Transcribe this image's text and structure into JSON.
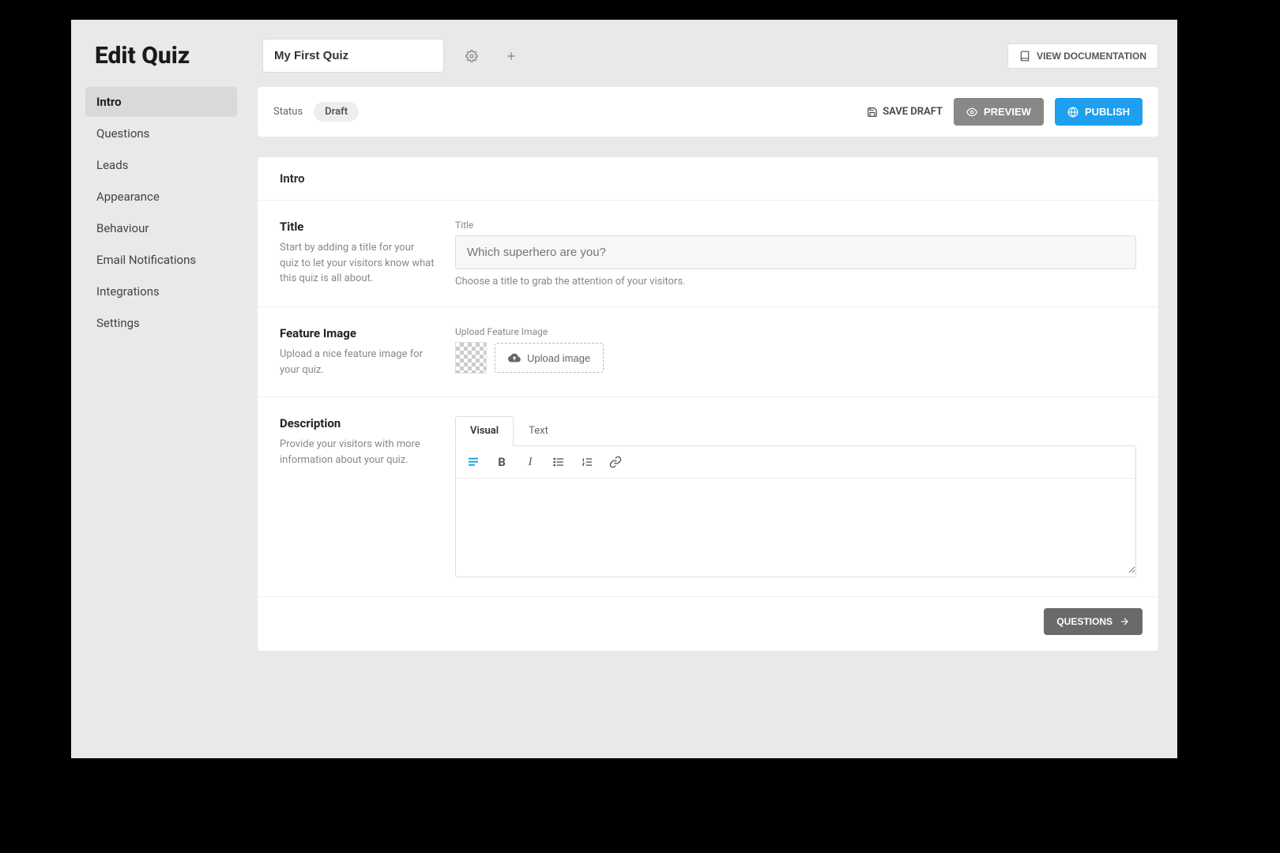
{
  "page": {
    "title": "Edit Quiz"
  },
  "quiz": {
    "name": "My First Quiz"
  },
  "header": {
    "view_docs": "VIEW DOCUMENTATION"
  },
  "sidebar": {
    "items": [
      {
        "label": "Intro",
        "active": true
      },
      {
        "label": "Questions"
      },
      {
        "label": "Leads"
      },
      {
        "label": "Appearance"
      },
      {
        "label": "Behaviour"
      },
      {
        "label": "Email Notifications"
      },
      {
        "label": "Integrations"
      },
      {
        "label": "Settings"
      }
    ]
  },
  "status_bar": {
    "status_label": "Status",
    "status_value": "Draft",
    "save_draft": "SAVE DRAFT",
    "preview": "PREVIEW",
    "publish": "PUBLISH"
  },
  "panel": {
    "heading": "Intro",
    "next_label": "QUESTIONS"
  },
  "title_section": {
    "heading": "Title",
    "desc": "Start by adding a title for your quiz to let your visitors know what this quiz is all about.",
    "field_label": "Title",
    "placeholder": "Which superhero are you?",
    "value": "",
    "help": "Choose a title to grab the attention of your visitors."
  },
  "image_section": {
    "heading": "Feature Image",
    "desc": "Upload a nice feature image for your quiz.",
    "field_label": "Upload Feature Image",
    "upload_label": "Upload image"
  },
  "description_section": {
    "heading": "Description",
    "desc": "Provide your visitors with more information about your quiz.",
    "tabs": {
      "visual": "Visual",
      "text": "Text"
    }
  }
}
